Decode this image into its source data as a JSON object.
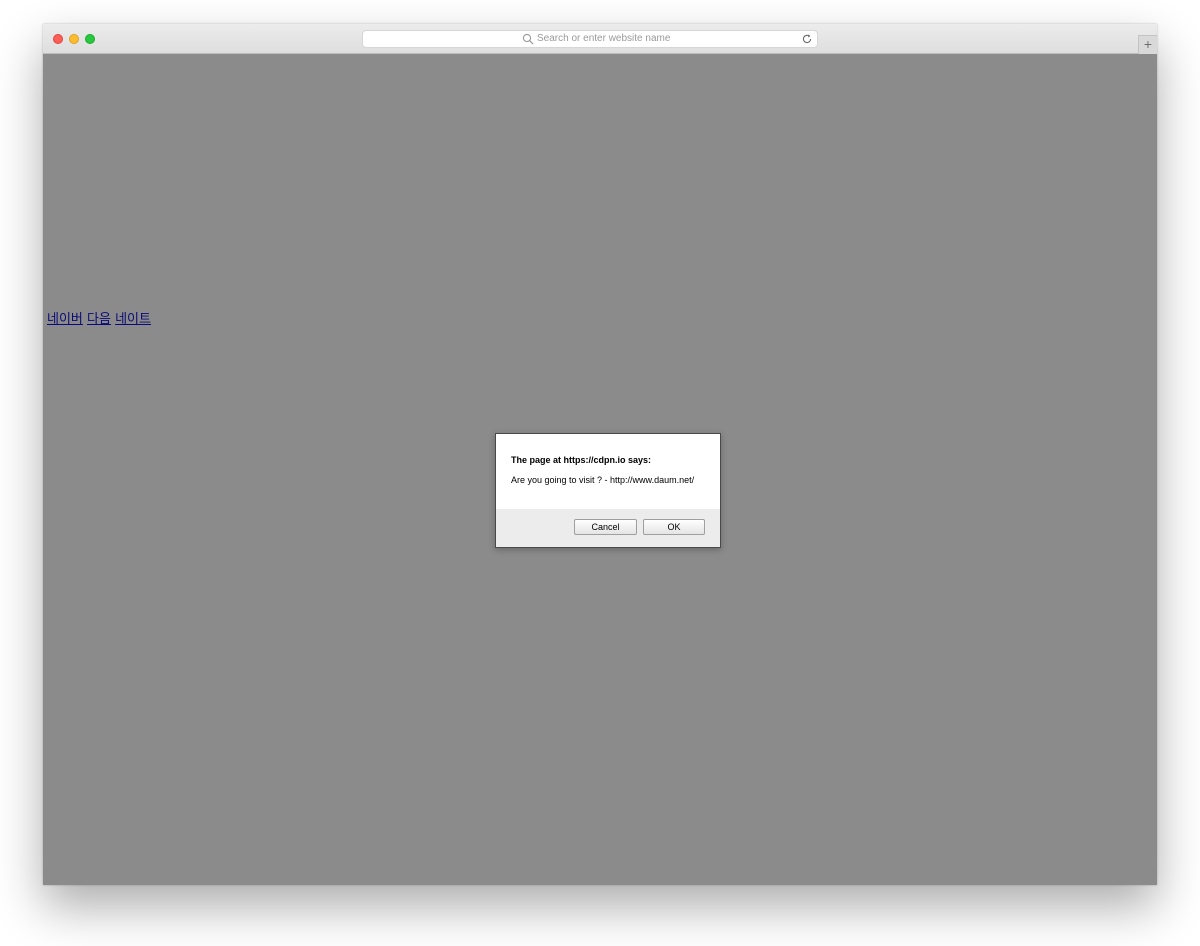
{
  "browser": {
    "address_placeholder": "Search or enter website name",
    "new_tab_label": "+",
    "traffic_lights": {
      "close_color": "#fc5f57",
      "minimize_color": "#fdbc2e",
      "maximize_color": "#28c840"
    }
  },
  "page": {
    "background_color": "#8b8b8b",
    "links": [
      {
        "label": "네이버"
      },
      {
        "label": "다음"
      },
      {
        "label": "네이트"
      }
    ]
  },
  "dialog": {
    "title": "The page at https://cdpn.io says:",
    "message": "Are you going to visit ? - http://www.daum.net/",
    "cancel_label": "Cancel",
    "ok_label": "OK"
  }
}
